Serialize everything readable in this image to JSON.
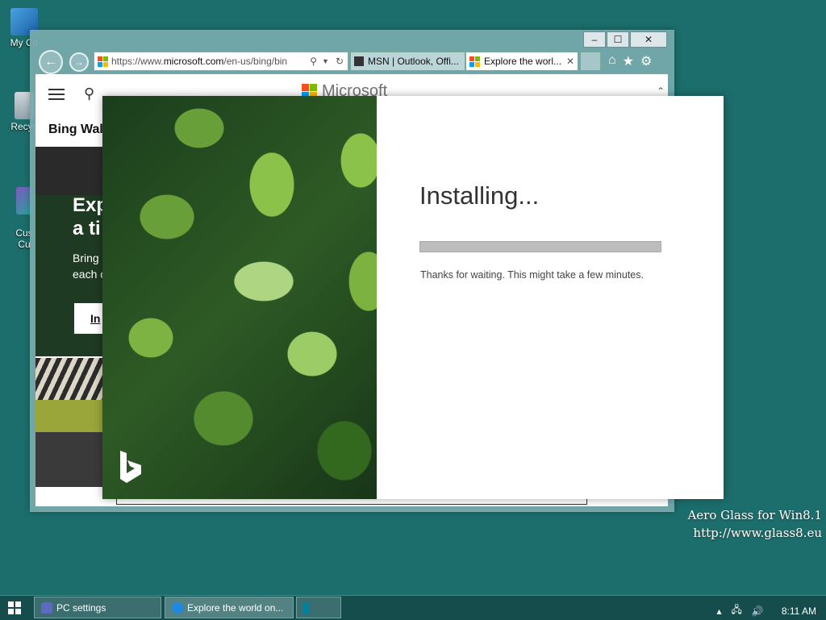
{
  "desktop": {
    "icons": [
      {
        "label": "My Co"
      },
      {
        "label": "Recyc"
      },
      {
        "label": "Cus\nCu"
      }
    ],
    "watermark": {
      "line1": "Aero Glass for Win8.1",
      "line2": "http://www.glass8.eu"
    }
  },
  "browser": {
    "window_buttons": {
      "minimize": "‒",
      "maximize": "☐",
      "close": "✕"
    },
    "address": {
      "url_prefix": "https://www.",
      "url_domain": "microsoft.com",
      "url_rest": "/en-us/bing/bin"
    },
    "tabs": [
      {
        "label": "MSN | Outlook, Offi..."
      },
      {
        "label": "Explore the worl..."
      }
    ],
    "page": {
      "brand": "Microsoft",
      "section_title": "Bing Wall",
      "hero_title_line1": "Exp",
      "hero_title_line2": "a ti",
      "hero_text_line1": "Bring",
      "hero_text_line2": "each c",
      "hero_button": "In"
    }
  },
  "installer": {
    "title": "Installing...",
    "message": "Thanks for waiting. This might take a few minutes.",
    "progress": 0.0
  },
  "taskbar": {
    "items": [
      {
        "label": "PC settings"
      },
      {
        "label": "Explore the world on..."
      },
      {
        "label": ""
      }
    ],
    "clock": "8:11 AM"
  },
  "colors": {
    "desktop": "#1b6e6c",
    "accent": "#0078d7",
    "ms_red": "#f25022",
    "ms_green": "#7fba00",
    "ms_blue": "#00a4ef",
    "ms_yellow": "#ffb900"
  }
}
